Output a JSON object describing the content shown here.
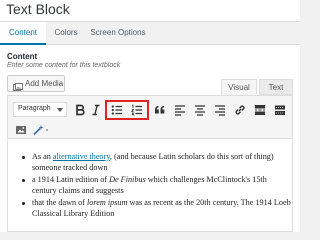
{
  "window": {
    "title": "Text Block"
  },
  "tabs": [
    {
      "label": "Content",
      "active": true
    },
    {
      "label": "Colors",
      "active": false
    },
    {
      "label": "Screen Options",
      "active": false
    }
  ],
  "field": {
    "label": "Content",
    "description": "Enter some content for this textblock"
  },
  "add_media": {
    "label": "Add Media",
    "icon": "media-icon"
  },
  "editor_tabs": [
    {
      "label": "Visual",
      "active": true
    },
    {
      "label": "Text",
      "active": false
    }
  ],
  "toolbar": {
    "format_select": {
      "value": "Paragraph"
    },
    "row1_buttons": [
      {
        "name": "bold-button",
        "icon": "bold-icon"
      },
      {
        "name": "italic-button",
        "icon": "italic-icon"
      },
      {
        "name": "bulleted-list-button",
        "icon": "bulleted-list-icon"
      },
      {
        "name": "numbered-list-button",
        "icon": "numbered-list-icon"
      },
      {
        "name": "blockquote-button",
        "icon": "blockquote-icon"
      },
      {
        "name": "align-left-button",
        "icon": "align-left-icon"
      },
      {
        "name": "align-center-button",
        "icon": "align-center-icon"
      },
      {
        "name": "align-right-button",
        "icon": "align-right-icon"
      },
      {
        "name": "insert-link-button",
        "icon": "link-icon"
      },
      {
        "name": "read-more-button",
        "icon": "read-more-icon"
      },
      {
        "name": "toolbar-toggle-button",
        "icon": "toolbar-toggle-icon"
      }
    ],
    "row2_buttons": [
      {
        "name": "wp-image-button",
        "icon": "image-icon"
      },
      {
        "name": "magic-wand-button",
        "icon": "wand-icon"
      }
    ],
    "highlight_color": "#e02424"
  },
  "content": {
    "items": [
      {
        "prefix": "As an ",
        "link": "alternative theory",
        "suffix": ", (and because Latin scholars do this sort of thing) someone tracked down"
      },
      {
        "prefix": "a 1914 Latin edition of ",
        "emphasis": "De Finibus",
        "suffix": " which challenges McClintock's 15th century claims and suggests"
      },
      {
        "prefix": "that the dawn of ",
        "emphasis": "lorem ipsum",
        "suffix": " was as recent as the 20th century. The 1914 Loeb Classical Library Edition"
      }
    ]
  },
  "colors": {
    "accent": "#0073aa",
    "highlight": "#e02424",
    "toolbar_bg": "#f5f5f5"
  }
}
